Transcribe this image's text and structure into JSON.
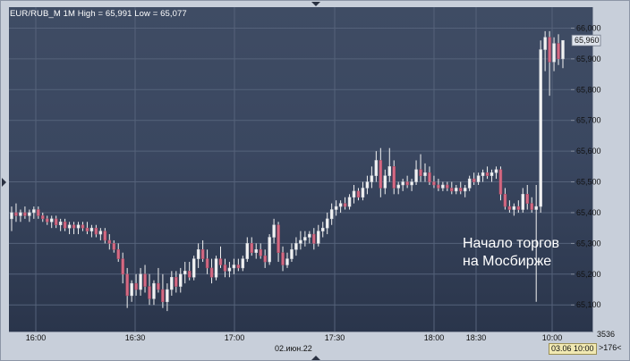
{
  "header": {
    "symbol": "EUR/RUB_M",
    "timeframe": "1M",
    "high_label": "High = 65,991",
    "low_label": "Low = 65,077"
  },
  "annotation": {
    "line1": "Начало торгов",
    "line2": "на Мосбирже"
  },
  "axis": {
    "date_label": "02.июн.22",
    "cursor_time": "03.06 10:00",
    "corner_readout": "3536",
    "zoom_hint": ">176<"
  },
  "colors": {
    "up": "#f2f2f2",
    "down": "#d56a83",
    "wick": "#f2f2f2",
    "grid": "#55627a",
    "last_price_box": "#dfe4ec"
  },
  "chart_data": {
    "type": "candlestick",
    "title": "",
    "xlabel": "02.июн.22",
    "ylabel": "",
    "ylim": [
      65.06,
      66.01
    ],
    "y_ticks": [
      "66,000",
      "65,900",
      "65,800",
      "65,700",
      "65,600",
      "65,500",
      "65,400",
      "65,300",
      "65,200",
      "65,100"
    ],
    "x_ticks": [
      "16:00",
      "16:30",
      "17:00",
      "17:30",
      "18:00",
      "18:30",
      "10:00"
    ],
    "last_price": "65,960",
    "high": 65.991,
    "low": 65.077,
    "grid": true,
    "series": [
      {
        "ohlc": [
          [
            65.38,
            65.42,
            65.34,
            65.4
          ],
          [
            65.4,
            65.43,
            65.37,
            65.39
          ],
          [
            65.39,
            65.41,
            65.37,
            65.4
          ],
          [
            65.4,
            65.42,
            65.38,
            65.39
          ],
          [
            65.39,
            65.41,
            65.37,
            65.4
          ],
          [
            65.4,
            65.42,
            65.38,
            65.41
          ],
          [
            65.41,
            65.42,
            65.38,
            65.39
          ],
          [
            65.39,
            65.4,
            65.37,
            65.38
          ],
          [
            65.38,
            65.39,
            65.36,
            65.37
          ],
          [
            65.37,
            65.39,
            65.35,
            65.38
          ],
          [
            65.38,
            65.39,
            65.35,
            65.36
          ],
          [
            65.36,
            65.38,
            65.34,
            65.37
          ],
          [
            65.37,
            65.38,
            65.34,
            65.35
          ],
          [
            65.35,
            65.37,
            65.33,
            65.36
          ],
          [
            65.36,
            65.37,
            65.33,
            65.35
          ],
          [
            65.35,
            65.37,
            65.33,
            65.36
          ],
          [
            65.36,
            65.37,
            65.34,
            65.35
          ],
          [
            65.35,
            65.37,
            65.33,
            65.34
          ],
          [
            65.34,
            65.36,
            65.32,
            65.35
          ],
          [
            65.35,
            65.36,
            65.32,
            65.33
          ],
          [
            65.33,
            65.35,
            65.31,
            65.34
          ],
          [
            65.34,
            65.35,
            65.3,
            65.31
          ],
          [
            65.31,
            65.33,
            65.28,
            65.3
          ],
          [
            65.3,
            65.31,
            65.27,
            65.28
          ],
          [
            65.28,
            65.3,
            65.24,
            65.25
          ],
          [
            65.25,
            65.27,
            65.17,
            65.2
          ],
          [
            65.2,
            65.22,
            65.09,
            65.13
          ],
          [
            65.13,
            65.18,
            65.11,
            65.17
          ],
          [
            65.17,
            65.2,
            65.13,
            65.15
          ],
          [
            65.15,
            65.22,
            65.13,
            65.2
          ],
          [
            65.2,
            65.23,
            65.14,
            65.16
          ],
          [
            65.16,
            65.2,
            65.1,
            65.12
          ],
          [
            65.12,
            65.18,
            65.1,
            65.17
          ],
          [
            65.17,
            65.22,
            65.14,
            65.15
          ],
          [
            65.15,
            65.2,
            65.09,
            65.11
          ],
          [
            65.11,
            65.17,
            65.08,
            65.15
          ],
          [
            65.15,
            65.21,
            65.13,
            65.19
          ],
          [
            65.19,
            65.21,
            65.14,
            65.16
          ],
          [
            65.16,
            65.22,
            65.14,
            65.2
          ],
          [
            65.2,
            65.24,
            65.17,
            65.21
          ],
          [
            65.21,
            65.24,
            65.18,
            65.19
          ],
          [
            65.19,
            65.26,
            65.18,
            65.25
          ],
          [
            65.25,
            65.3,
            65.22,
            65.28
          ],
          [
            65.28,
            65.31,
            65.24,
            65.25
          ],
          [
            65.25,
            65.28,
            65.2,
            65.22
          ],
          [
            65.22,
            65.25,
            65.17,
            65.19
          ],
          [
            65.19,
            65.26,
            65.18,
            65.25
          ],
          [
            65.25,
            65.29,
            65.22,
            65.23
          ],
          [
            65.23,
            65.25,
            65.19,
            65.21
          ],
          [
            65.21,
            65.24,
            65.19,
            65.22
          ],
          [
            65.22,
            65.25,
            65.2,
            65.23
          ],
          [
            65.23,
            65.25,
            65.21,
            65.22
          ],
          [
            65.22,
            65.26,
            65.21,
            65.25
          ],
          [
            65.25,
            65.32,
            65.24,
            65.3
          ],
          [
            65.3,
            65.32,
            65.26,
            65.27
          ],
          [
            65.27,
            65.3,
            65.25,
            65.28
          ],
          [
            65.28,
            65.3,
            65.25,
            65.26
          ],
          [
            65.26,
            65.28,
            65.22,
            65.24
          ],
          [
            65.24,
            65.33,
            65.23,
            65.32
          ],
          [
            65.32,
            65.38,
            65.3,
            65.36
          ],
          [
            65.36,
            65.37,
            65.24,
            65.27
          ],
          [
            65.27,
            65.29,
            65.21,
            65.23
          ],
          [
            65.23,
            65.27,
            65.22,
            65.25
          ],
          [
            65.25,
            65.3,
            65.24,
            65.28
          ],
          [
            65.28,
            65.32,
            65.26,
            65.3
          ],
          [
            65.3,
            65.34,
            65.28,
            65.31
          ],
          [
            65.31,
            65.34,
            65.29,
            65.32
          ],
          [
            65.32,
            65.34,
            65.3,
            65.33
          ],
          [
            65.33,
            65.35,
            65.28,
            65.3
          ],
          [
            65.3,
            65.36,
            65.29,
            65.34
          ],
          [
            65.34,
            65.37,
            65.32,
            65.35
          ],
          [
            65.35,
            65.4,
            65.33,
            65.38
          ],
          [
            65.38,
            65.43,
            65.36,
            65.41
          ],
          [
            65.41,
            65.44,
            65.39,
            65.42
          ],
          [
            65.42,
            65.44,
            65.4,
            65.43
          ],
          [
            65.43,
            65.45,
            65.41,
            65.42
          ],
          [
            65.42,
            65.46,
            65.41,
            65.45
          ],
          [
            65.45,
            65.49,
            65.43,
            65.47
          ],
          [
            65.47,
            65.48,
            65.44,
            65.45
          ],
          [
            65.45,
            65.5,
            65.44,
            65.48
          ],
          [
            65.48,
            65.52,
            65.46,
            65.5
          ],
          [
            65.5,
            65.55,
            65.48,
            65.52
          ],
          [
            65.52,
            65.6,
            65.5,
            65.57
          ],
          [
            65.57,
            65.61,
            65.45,
            65.48
          ],
          [
            65.48,
            65.54,
            65.46,
            65.52
          ],
          [
            65.52,
            65.61,
            65.5,
            65.55
          ],
          [
            65.55,
            65.57,
            65.46,
            65.48
          ],
          [
            65.48,
            65.5,
            65.46,
            65.49
          ],
          [
            65.49,
            65.51,
            65.47,
            65.5
          ],
          [
            65.5,
            65.52,
            65.48,
            65.49
          ],
          [
            65.49,
            65.51,
            65.47,
            65.5
          ],
          [
            65.5,
            65.57,
            65.49,
            65.54
          ],
          [
            65.54,
            65.59,
            65.5,
            65.52
          ],
          [
            65.52,
            65.56,
            65.5,
            65.53
          ],
          [
            65.53,
            65.55,
            65.49,
            65.5
          ],
          [
            65.5,
            65.52,
            65.48,
            65.49
          ],
          [
            65.49,
            65.51,
            65.47,
            65.48
          ],
          [
            65.48,
            65.5,
            65.47,
            65.49
          ],
          [
            65.49,
            65.5,
            65.47,
            65.48
          ],
          [
            65.48,
            65.5,
            65.46,
            65.47
          ],
          [
            65.47,
            65.49,
            65.46,
            65.48
          ],
          [
            65.48,
            65.5,
            65.46,
            65.47
          ],
          [
            65.47,
            65.49,
            65.45,
            65.48
          ],
          [
            65.48,
            65.52,
            65.47,
            65.51
          ],
          [
            65.51,
            65.53,
            65.49,
            65.5
          ],
          [
            65.5,
            65.53,
            65.49,
            65.52
          ],
          [
            65.52,
            65.54,
            65.5,
            65.53
          ],
          [
            65.53,
            65.55,
            65.51,
            65.52
          ],
          [
            65.52,
            65.54,
            65.5,
            65.53
          ],
          [
            65.53,
            65.55,
            65.51,
            65.54
          ],
          [
            65.54,
            65.55,
            65.44,
            65.46
          ],
          [
            65.46,
            65.48,
            65.41,
            65.42
          ],
          [
            65.42,
            65.44,
            65.4,
            65.41
          ],
          [
            65.41,
            65.43,
            65.39,
            65.42
          ],
          [
            65.42,
            65.44,
            65.4,
            65.41
          ],
          [
            65.41,
            65.48,
            65.4,
            65.46
          ],
          [
            65.46,
            65.49,
            65.41,
            65.43
          ],
          [
            65.43,
            65.45,
            65.4,
            65.41
          ],
          [
            65.41,
            65.49,
            65.11,
            65.42
          ],
          [
            65.42,
            65.96,
            65.4,
            65.93
          ],
          [
            65.93,
            65.99,
            65.86,
            65.97
          ],
          [
            65.97,
            65.99,
            65.78,
            65.89
          ],
          [
            65.89,
            65.97,
            65.86,
            65.95
          ],
          [
            65.95,
            65.98,
            65.88,
            65.9
          ],
          [
            65.9,
            65.96,
            65.87,
            65.96
          ]
        ]
      }
    ]
  }
}
